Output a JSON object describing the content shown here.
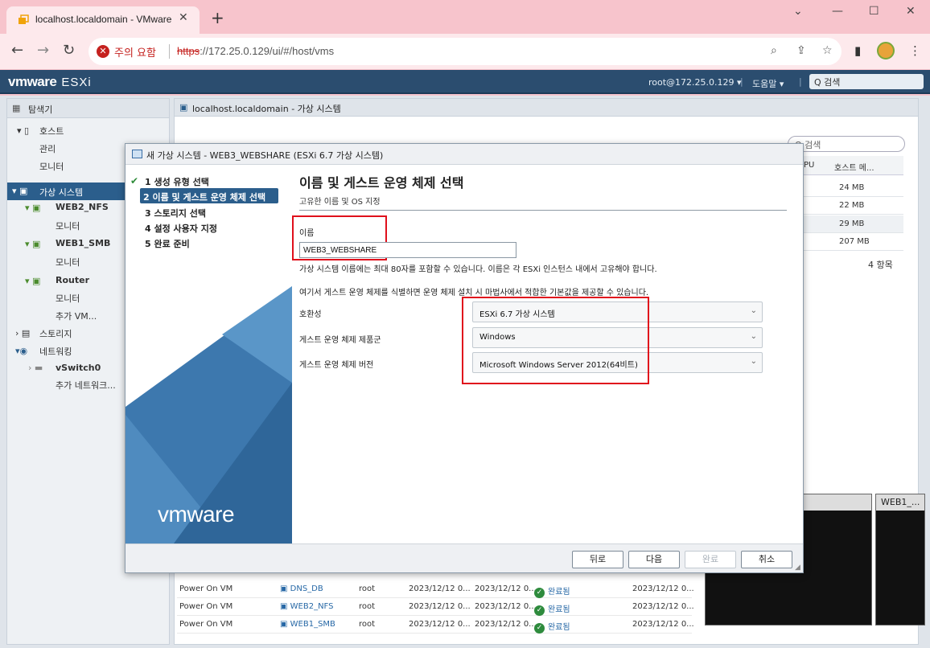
{
  "browser": {
    "tab_title": "localhost.localdomain - VMware",
    "tab_close": "✕",
    "new_tab": "+",
    "security_label": "주의 요함",
    "url_protocol": "https",
    "url_rest": "://172.25.0.129/ui/#/host/vms",
    "window_controls": {
      "minimize": "—",
      "maximize": "☐",
      "close": "✕",
      "chevron": "⌄"
    }
  },
  "esxi_header": {
    "logo": "vmware",
    "product": "ESXi",
    "user": "root@172.25.0.129 ▾",
    "help": "도움말 ▾",
    "search_placeholder": "Q 검색"
  },
  "navigator": {
    "title": "탐색기",
    "items": [
      {
        "label": "호스트"
      },
      {
        "label": "관리"
      },
      {
        "label": "모니터"
      },
      {
        "label": "가상 시스템"
      },
      {
        "label": "WEB2_NFS"
      },
      {
        "label": "모니터"
      },
      {
        "label": "WEB1_SMB"
      },
      {
        "label": "모니터"
      },
      {
        "label": "Router"
      },
      {
        "label": "모니터"
      },
      {
        "label": "추가 VM..."
      },
      {
        "label": "스토리지"
      },
      {
        "label": "네트워킹"
      },
      {
        "label": "vSwitch0"
      },
      {
        "label": "추가 네트워크..."
      }
    ]
  },
  "content": {
    "title": "localhost.localdomain - 가상 시스템",
    "search_placeholder": "Q 검색",
    "table_headers": [
      "PU",
      "호스트 메..."
    ],
    "table_rows": [
      "24 MB",
      "22 MB",
      "29 MB",
      "207 MB"
    ],
    "item_count": "4 항목"
  },
  "tasks": [
    {
      "task": "Power On VM",
      "target": "DNS_DB",
      "user": "root",
      "time": "2023/12/12 0...",
      "time2": "2023/12/12 0...",
      "status": "완료됨",
      "time3": "2023/12/12 0..."
    },
    {
      "task": "Power On VM",
      "target": "WEB2_NFS",
      "user": "root",
      "time": "2023/12/12 0...",
      "time2": "2023/12/12 0...",
      "status": "완료됨",
      "time3": "2023/12/12 0..."
    },
    {
      "task": "Power On VM",
      "target": "WEB1_SMB",
      "user": "root",
      "time": "2023/12/12 0...",
      "time2": "2023/12/12 0...",
      "status": "완료됨",
      "time3": "2023/12/12 0..."
    }
  ],
  "consoles": [
    {
      "title": ""
    },
    {
      "title": "WEB1_..."
    }
  ],
  "wizard": {
    "title": "새 가상 시스템 - WEB3_WEBSHARE (ESXi 6.7 가상 시스템)",
    "steps": [
      {
        "label": "1 생성 유형 선택",
        "done": true
      },
      {
        "label": "2 이름 및 게스트 운영 체제 선택",
        "active": true
      },
      {
        "label": "3 스토리지 선택"
      },
      {
        "label": "4 설정 사용자 지정"
      },
      {
        "label": "5 완료 준비"
      }
    ],
    "brand": "vmware",
    "heading": "이름 및 게스트 운영 체제 선택",
    "subheading": "고유한 이름 및 OS 지정",
    "name_label": "이름",
    "name_value": "WEB3_WEBSHARE",
    "name_hint": "가상 시스템 이름에는 최대 80자를 포함할 수 있습니다. 이름은 각 ESXi 인스턴스 내에서 고유해야 합니다.",
    "os_hint": "여기서 게스트 운영 체제를 식별하면 운영 체제 설치 시 마법사에서 적합한 기본값을 제공할 수 있습니다.",
    "compat_label": "호환성",
    "compat_value": "ESXi 6.7 가상 시스템",
    "family_label": "게스트 운영 체제 제품군",
    "family_value": "Windows",
    "version_label": "게스트 운영 체제 버전",
    "version_value": "Microsoft Windows Server 2012(64비트)",
    "buttons": {
      "back": "뒤로",
      "next": "다음",
      "finish": "완료",
      "cancel": "취소"
    }
  },
  "colors": {
    "accent": "#2b5e8c",
    "highlight_box": "#e0101c",
    "header": "#2b4d6f"
  }
}
